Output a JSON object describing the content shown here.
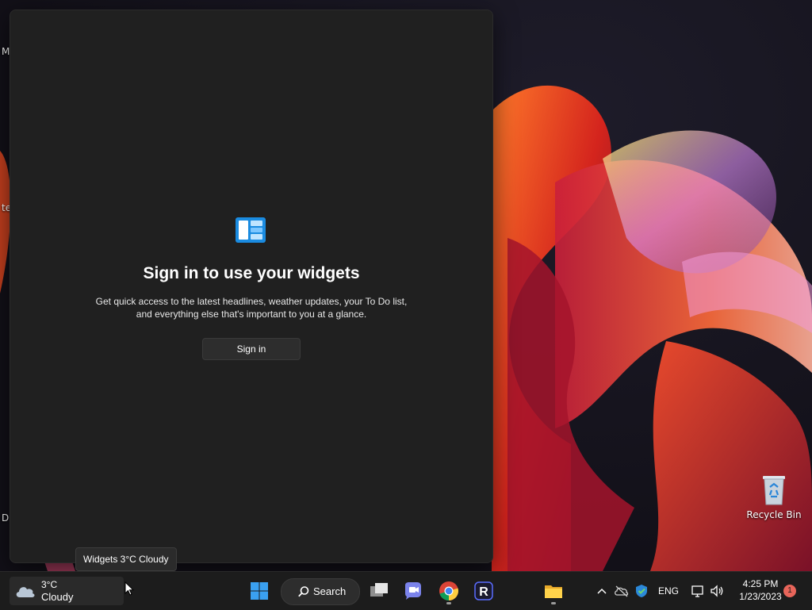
{
  "desktop": {
    "edge_labels": [
      "M",
      "te",
      "D"
    ],
    "recycle_bin_label": "Recycle Bin"
  },
  "widgets_panel": {
    "title": "Sign in to use your widgets",
    "description": "Get quick access to the latest headlines, weather updates, your To Do list, and everything else that's important to you at a glance.",
    "signin_label": "Sign in"
  },
  "tooltip": {
    "text": "Widgets 3°C Cloudy"
  },
  "taskbar": {
    "weather": {
      "temperature": "3°C",
      "condition": "Cloudy",
      "icon": "cloud-icon"
    },
    "search_label": "Search",
    "apps": [
      {
        "name": "Start",
        "icon": "windows-start-icon"
      },
      {
        "name": "Task View",
        "icon": "task-view-icon"
      },
      {
        "name": "Chat",
        "icon": "teams-chat-icon"
      },
      {
        "name": "Google Chrome",
        "icon": "chrome-icon"
      },
      {
        "name": "R",
        "icon": "r-app-icon"
      },
      {
        "name": "File Explorer",
        "icon": "folder-icon"
      }
    ],
    "tray": {
      "language": "ENG",
      "time": "4:25 PM",
      "date": "1/23/2023",
      "notification_count": "1"
    }
  },
  "colors": {
    "panel_bg": "#202020",
    "taskbar_bg": "#1c1c1c",
    "accent": "#0078d4"
  }
}
